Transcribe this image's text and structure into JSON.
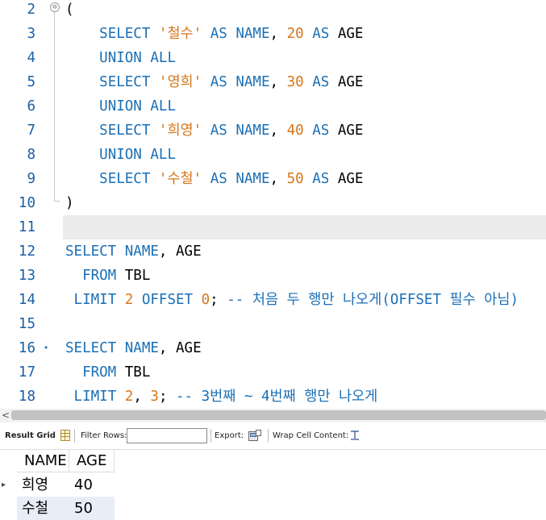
{
  "editor": {
    "lines": [
      {
        "n": "2",
        "tokens": [
          {
            "t": "(",
            "c": ""
          }
        ]
      },
      {
        "n": "3",
        "tokens": [
          {
            "t": "    ",
            "c": ""
          },
          {
            "t": "SELECT ",
            "c": "kw"
          },
          {
            "t": "'철수'",
            "c": "str"
          },
          {
            "t": " AS NAME",
            "c": "kw"
          },
          {
            "t": ", ",
            "c": ""
          },
          {
            "t": "20",
            "c": "num"
          },
          {
            "t": " AS ",
            "c": "kw"
          },
          {
            "t": "AGE",
            "c": ""
          }
        ]
      },
      {
        "n": "4",
        "tokens": [
          {
            "t": "    ",
            "c": ""
          },
          {
            "t": "UNION ALL",
            "c": "kw"
          }
        ]
      },
      {
        "n": "5",
        "tokens": [
          {
            "t": "    ",
            "c": ""
          },
          {
            "t": "SELECT ",
            "c": "kw"
          },
          {
            "t": "'영희'",
            "c": "str"
          },
          {
            "t": " AS NAME",
            "c": "kw"
          },
          {
            "t": ", ",
            "c": ""
          },
          {
            "t": "30",
            "c": "num"
          },
          {
            "t": " AS ",
            "c": "kw"
          },
          {
            "t": "AGE",
            "c": ""
          }
        ]
      },
      {
        "n": "6",
        "tokens": [
          {
            "t": "    ",
            "c": ""
          },
          {
            "t": "UNION ALL",
            "c": "kw"
          }
        ]
      },
      {
        "n": "7",
        "tokens": [
          {
            "t": "    ",
            "c": ""
          },
          {
            "t": "SELECT ",
            "c": "kw"
          },
          {
            "t": "'희영'",
            "c": "str"
          },
          {
            "t": " AS NAME",
            "c": "kw"
          },
          {
            "t": ", ",
            "c": ""
          },
          {
            "t": "40",
            "c": "num"
          },
          {
            "t": " AS ",
            "c": "kw"
          },
          {
            "t": "AGE",
            "c": ""
          }
        ]
      },
      {
        "n": "8",
        "tokens": [
          {
            "t": "    ",
            "c": ""
          },
          {
            "t": "UNION ALL",
            "c": "kw"
          }
        ]
      },
      {
        "n": "9",
        "tokens": [
          {
            "t": "    ",
            "c": ""
          },
          {
            "t": "SELECT ",
            "c": "kw"
          },
          {
            "t": "'수철'",
            "c": "str"
          },
          {
            "t": " AS NAME",
            "c": "kw"
          },
          {
            "t": ", ",
            "c": ""
          },
          {
            "t": "50",
            "c": "num"
          },
          {
            "t": " AS ",
            "c": "kw"
          },
          {
            "t": "AGE",
            "c": ""
          }
        ]
      },
      {
        "n": "10",
        "tokens": [
          {
            "t": ")",
            "c": ""
          }
        ]
      },
      {
        "n": "11",
        "tokens": []
      },
      {
        "n": "12",
        "tokens": [
          {
            "t": "SELECT ",
            "c": "kw"
          },
          {
            "t": "NAME",
            "c": "kw"
          },
          {
            "t": ", ",
            "c": ""
          },
          {
            "t": "AGE",
            "c": ""
          }
        ]
      },
      {
        "n": "13",
        "tokens": [
          {
            "t": "  ",
            "c": ""
          },
          {
            "t": "FROM ",
            "c": "kw"
          },
          {
            "t": "TBL",
            "c": ""
          }
        ]
      },
      {
        "n": "14",
        "tokens": [
          {
            "t": " ",
            "c": ""
          },
          {
            "t": "LIMIT ",
            "c": "kw"
          },
          {
            "t": "2",
            "c": "num"
          },
          {
            "t": " OFFSET ",
            "c": "kw"
          },
          {
            "t": "0",
            "c": "num"
          },
          {
            "t": "; ",
            "c": ""
          },
          {
            "t": "-- 처음 두 행만 나오게(OFFSET 필수 아님)",
            "c": "cmt"
          }
        ]
      },
      {
        "n": "15",
        "tokens": []
      },
      {
        "n": "16",
        "tokens": [
          {
            "t": "SELECT ",
            "c": "kw"
          },
          {
            "t": "NAME",
            "c": "kw"
          },
          {
            "t": ", ",
            "c": ""
          },
          {
            "t": "AGE",
            "c": ""
          }
        ]
      },
      {
        "n": "17",
        "tokens": [
          {
            "t": "  ",
            "c": ""
          },
          {
            "t": "FROM ",
            "c": "kw"
          },
          {
            "t": "TBL",
            "c": ""
          }
        ]
      },
      {
        "n": "18",
        "tokens": [
          {
            "t": " ",
            "c": ""
          },
          {
            "t": "LIMIT ",
            "c": "kw"
          },
          {
            "t": "2",
            "c": "num"
          },
          {
            "t": ", ",
            "c": ""
          },
          {
            "t": "3",
            "c": "num"
          },
          {
            "t": "; ",
            "c": ""
          },
          {
            "t": "-- 3번째 ~ 4번째 행만 나오게",
            "c": "cmt"
          }
        ]
      }
    ],
    "current_line": "11",
    "statement_marker_line": "16",
    "statement_marker_glyph": "•",
    "fold_open_glyph": "⊖"
  },
  "scrollbar": {
    "left_arrow": "<"
  },
  "toolbar": {
    "result_grid": "Result Grid",
    "filter_rows": "Filter Rows:",
    "filter_value": "",
    "export": "Export:",
    "wrap": "Wrap Cell Content:"
  },
  "grid": {
    "columns": [
      "NAME",
      "AGE"
    ],
    "rows": [
      {
        "name": "희영",
        "age": "40",
        "marker": "▸"
      },
      {
        "name": "수철",
        "age": "50",
        "marker": ""
      }
    ]
  },
  "colors": {
    "keyword": "#1a6fb5",
    "string": "#d5761a",
    "number": "#d5761a",
    "line_number": "#1a5fa5"
  }
}
